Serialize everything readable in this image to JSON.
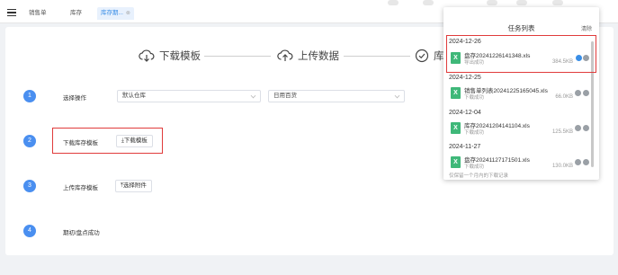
{
  "tabs": [
    {
      "label": "销售单"
    },
    {
      "label": "库存"
    },
    {
      "label": "库存期..."
    }
  ],
  "steps": [
    {
      "label": "下载模板"
    },
    {
      "label": "上传数据"
    },
    {
      "label": "库存"
    }
  ],
  "rows": [
    {
      "num": "1",
      "label": "选择操作",
      "select1": "默认仓库",
      "select2": "日用百货"
    },
    {
      "num": "2",
      "label": "下载库存模板",
      "button": "⤓下载模板"
    },
    {
      "num": "3",
      "label": "上传库存模板",
      "button": "⤒选择附件"
    },
    {
      "num": "4",
      "label": "期初/盘点成功"
    }
  ],
  "task_panel": {
    "title": "任务列表",
    "clear_label": "清除",
    "groups": [
      {
        "date": "2024-12-26",
        "file": "盘存20241226141348.xls",
        "status": "导出成功",
        "size": "384.5KB"
      },
      {
        "date": "2024-12-25",
        "file": "销售单列表20241225165045.xls",
        "status": "下载成功",
        "size": "66.0KB"
      },
      {
        "date": "2024-12-04",
        "file": "库存20241204141104.xls",
        "status": "下载成功",
        "size": "125.5KB"
      },
      {
        "date": "2024-11-27",
        "file": "盘存20241127171501.xls",
        "status": "下载成功",
        "size": "130.0KB"
      }
    ],
    "footer": "仅保留一个月内的下载记录"
  },
  "colors": {
    "accent": "#4a8ff0",
    "highlight_box": "#e03b3b",
    "excel": "#3fb879"
  }
}
